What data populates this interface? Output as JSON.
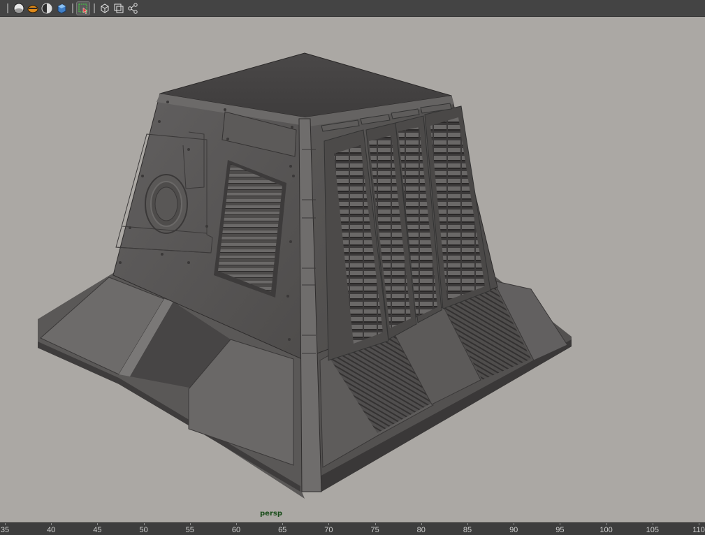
{
  "toolbar": {
    "buttons": [
      {
        "icon": "shaded-sphere-icon"
      },
      {
        "icon": "textured-sphere-icon"
      },
      {
        "icon": "lighting-icon"
      },
      {
        "icon": "shadow-cube-icon"
      },
      {
        "icon": "isolate-select-icon"
      },
      {
        "icon": "wireframe-cube-icon"
      },
      {
        "icon": "xray-icon"
      },
      {
        "icon": "joint-icon"
      }
    ]
  },
  "viewport": {
    "camera_label": "persp",
    "background_color": "#aba8a4"
  },
  "timeline": {
    "labels": [
      "35",
      "40",
      "45",
      "50",
      "55",
      "60",
      "65",
      "70",
      "75",
      "80",
      "85",
      "90",
      "95",
      "100",
      "105",
      "110"
    ]
  }
}
